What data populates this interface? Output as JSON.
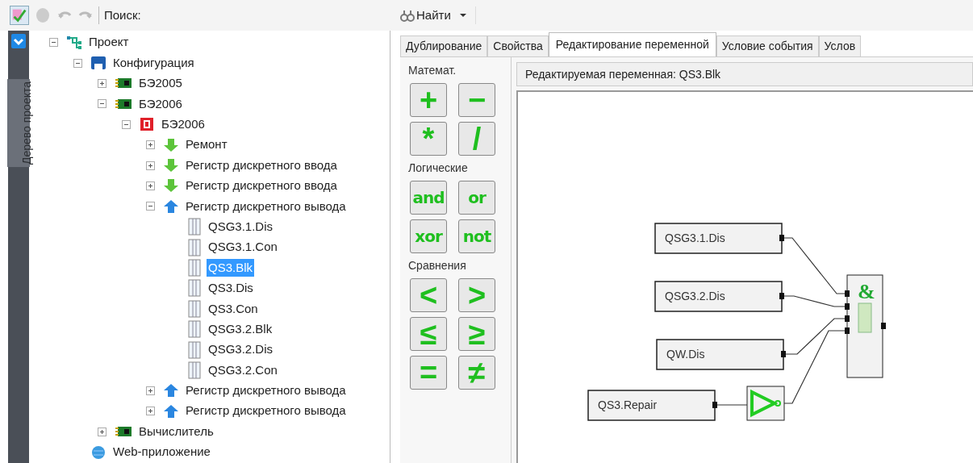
{
  "toolbar": {
    "search_label": "Поиск:",
    "find_button": "Найти"
  },
  "side_tab": {
    "label": "Дерево проекта"
  },
  "tree": [
    {
      "label": "Проект",
      "kind": "project",
      "expanded": true,
      "selected": false,
      "children": [
        {
          "label": "Конфигурация",
          "kind": "config",
          "expanded": true,
          "selected": false,
          "children": [
            {
              "label": "БЭ2005",
              "kind": "device",
              "expanded": false,
              "selected": false
            },
            {
              "label": "БЭ2006",
              "kind": "device",
              "expanded": true,
              "selected": false,
              "children": [
                {
                  "label": "БЭ2006",
                  "kind": "module",
                  "expanded": true,
                  "selected": false,
                  "children": [
                    {
                      "label": "Ремонт",
                      "kind": "input",
                      "expanded": false,
                      "selected": false
                    },
                    {
                      "label": "Регистр дискретного ввода",
                      "kind": "input",
                      "expanded": false,
                      "selected": false
                    },
                    {
                      "label": "Регистр дискретного ввода",
                      "kind": "input",
                      "expanded": false,
                      "selected": false
                    },
                    {
                      "label": "Регистр дискретного вывода",
                      "kind": "output",
                      "expanded": true,
                      "selected": false,
                      "children": [
                        {
                          "label": "QSG3.1.Dis",
                          "kind": "variable",
                          "selected": false
                        },
                        {
                          "label": "QSG3.1.Con",
                          "kind": "variable",
                          "selected": false
                        },
                        {
                          "label": "QS3.Blk",
                          "kind": "variable",
                          "selected": true
                        },
                        {
                          "label": "QS3.Dis",
                          "kind": "variable",
                          "selected": false
                        },
                        {
                          "label": "QS3.Con",
                          "kind": "variable",
                          "selected": false
                        },
                        {
                          "label": "QSG3.2.Blk",
                          "kind": "variable",
                          "selected": false
                        },
                        {
                          "label": "QSG3.2.Dis",
                          "kind": "variable",
                          "selected": false
                        },
                        {
                          "label": "QSG3.2.Con",
                          "kind": "variable",
                          "selected": false
                        }
                      ]
                    },
                    {
                      "label": "Регистр дискретного вывода",
                      "kind": "output",
                      "expanded": false,
                      "selected": false
                    },
                    {
                      "label": "Регистр дискретного вывода",
                      "kind": "output",
                      "expanded": false,
                      "selected": false
                    }
                  ]
                }
              ]
            },
            {
              "label": "Вычислитель",
              "kind": "device",
              "expanded": false,
              "selected": false
            }
          ]
        },
        {
          "label": "Web-приложение",
          "kind": "web",
          "selected": false
        }
      ]
    }
  ],
  "tabs": [
    {
      "label": "Дублирование",
      "selected": false
    },
    {
      "label": "Свойства",
      "selected": false
    },
    {
      "label": "Редактирование переменной",
      "selected": true
    },
    {
      "label": "Условие события",
      "selected": false
    },
    {
      "label": "Услов",
      "selected": false
    }
  ],
  "palette": [
    {
      "title": "Математ.",
      "buttons": [
        "+",
        "−",
        "*",
        "/"
      ]
    },
    {
      "title": "Логические",
      "buttons": [
        "and",
        "or",
        "xor",
        "not"
      ]
    },
    {
      "title": "Сравнения",
      "buttons": [
        "<",
        ">",
        "≤",
        "≥",
        "=",
        "≠"
      ]
    }
  ],
  "editor": {
    "header": "Редактируемая переменная: QS3.Blk",
    "diagram": {
      "inputs": [
        {
          "label": "QSG3.1.Dis"
        },
        {
          "label": "QSG3.2.Dis"
        },
        {
          "label": "QW.Dis"
        },
        {
          "label": "QS3.Repair"
        }
      ],
      "and_gate": {
        "symbol": "&"
      }
    }
  }
}
